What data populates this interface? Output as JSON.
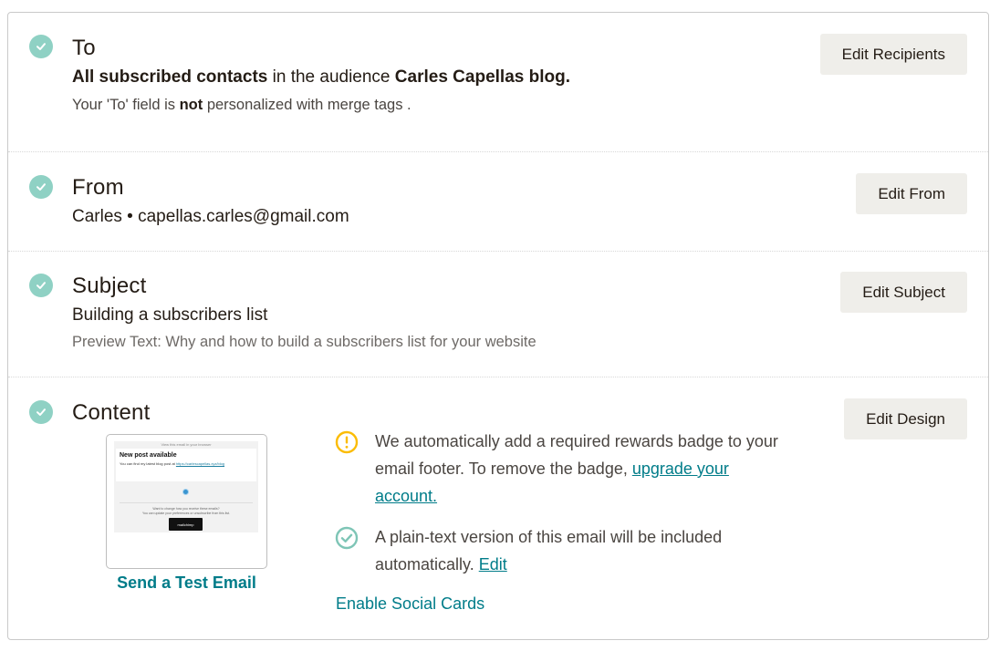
{
  "sections": {
    "to": {
      "title": "To",
      "line1_bold": "All subscribed contacts",
      "line1_mid": " in the audience ",
      "line1_audience": "Carles Capellas blog.",
      "line2_pre": "Your 'To' field is ",
      "line2_bold": "not",
      "line2_post": " personalized with merge tags .",
      "button": "Edit Recipients",
      "status_icon": "check-circle-icon"
    },
    "from": {
      "title": "From",
      "line1": "Carles • capellas.carles@gmail.com",
      "button": "Edit From",
      "status_icon": "check-circle-icon"
    },
    "subject": {
      "title": "Subject",
      "line1": "Building a subscribers list",
      "line2": "Preview Text: Why and how to build a subscribers list for your website",
      "button": "Edit Subject",
      "status_icon": "check-circle-icon"
    },
    "content": {
      "title": "Content",
      "button": "Edit Design",
      "status_icon": "check-circle-icon",
      "thumbnail": {
        "topbar": "View this email in your browser",
        "heading": "New post available",
        "body_pre": "You can find my latest blog post at ",
        "body_link": "https://carlescapellas.xyz/blog",
        "footer_line1": "Want to change how you receive these emails?",
        "footer_line2": "You can update your preferences or unsubscribe from this list.",
        "badge": "mailchimp"
      },
      "send_test": "Send a Test Email",
      "notice_badge": {
        "icon": "warning-circle-icon",
        "text": "We automatically add a required rewards badge to your email footer. To remove the badge, ",
        "link": "upgrade your account."
      },
      "notice_plaintext": {
        "icon": "check-outline-icon",
        "text": "A plain-text version of this email will be included automatically. ",
        "link": "Edit"
      },
      "social_link": "Enable Social Cards"
    }
  },
  "colors": {
    "accent": "#007c89",
    "check": "#8fd1c4",
    "warning": "#fbbc05",
    "button_bg": "#efeeea"
  }
}
